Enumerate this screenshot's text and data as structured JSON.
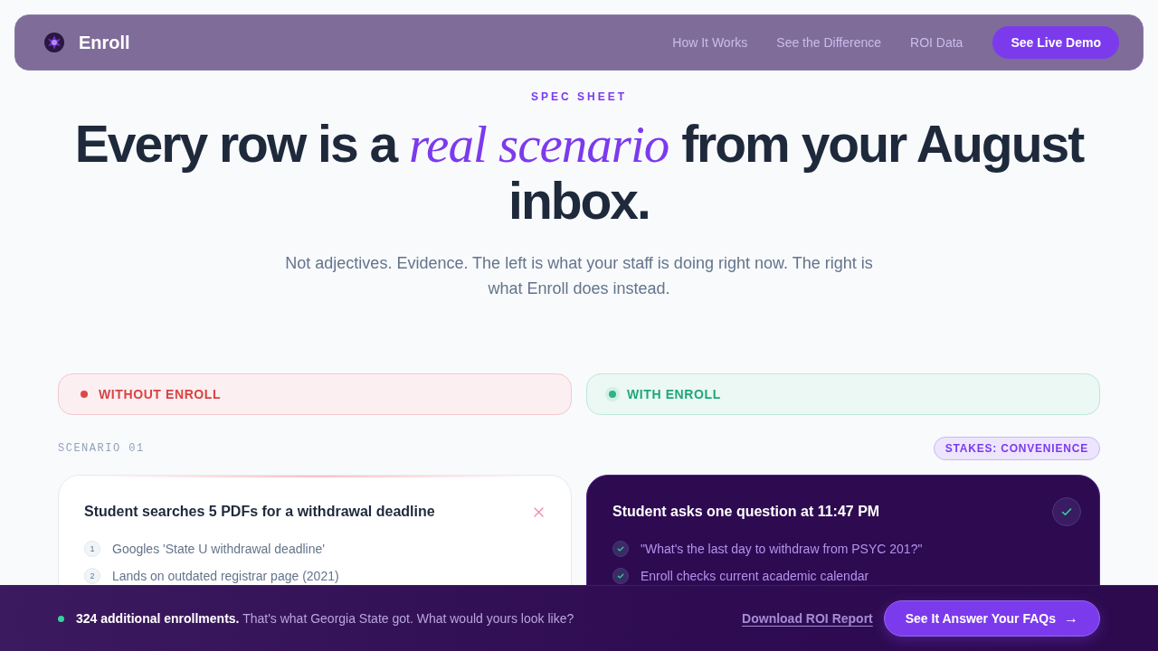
{
  "nav": {
    "brand": "Enroll",
    "links": [
      "How It Works",
      "See the Difference",
      "ROI Data"
    ],
    "cta": "See Live Demo"
  },
  "hero": {
    "eyebrow": "SPEC SHEET",
    "headline": "Every row is a *real scenario* from your August inbox.",
    "subtitle": "Not adjectives. Evidence. The left is what your staff is doing right now. The right is what Enroll does instead."
  },
  "comparison": {
    "columns": [
      {
        "kind": "without",
        "label": "WITHOUT ENROLL",
        "color": "#e04848"
      },
      {
        "kind": "with",
        "label": "WITH ENROLL",
        "color": "#2bb585"
      }
    ],
    "scenarios": [
      {
        "label": "SCENARIO 01",
        "stakes": "STAKES: CONVENIENCE",
        "cards": [
          {
            "kind": "without",
            "title": "Student searches 5 PDFs for a withdrawal deadline",
            "steps": [
              {
                "number": "1",
                "text": "Googles 'State U withdrawal deadline'"
              },
              {
                "number": "2",
                "text": "Lands on outdated registrar page (2021)"
              }
            ]
          },
          {
            "kind": "with",
            "title": "Student asks one question at 11:47 PM",
            "steps": [
              {
                "text": "\"What's the last day to withdraw from PSYC 201?\""
              },
              {
                "text": "Enroll checks current academic calendar"
              }
            ]
          }
        ]
      }
    ]
  },
  "cta_bar": {
    "message": "**324 additional enrollments.** That's what Georgia State got. What would yours look like?",
    "link": "Download ROI Report",
    "button": {
      "label": "See It Answer Your FAQs",
      "icon": "→"
    }
  }
}
